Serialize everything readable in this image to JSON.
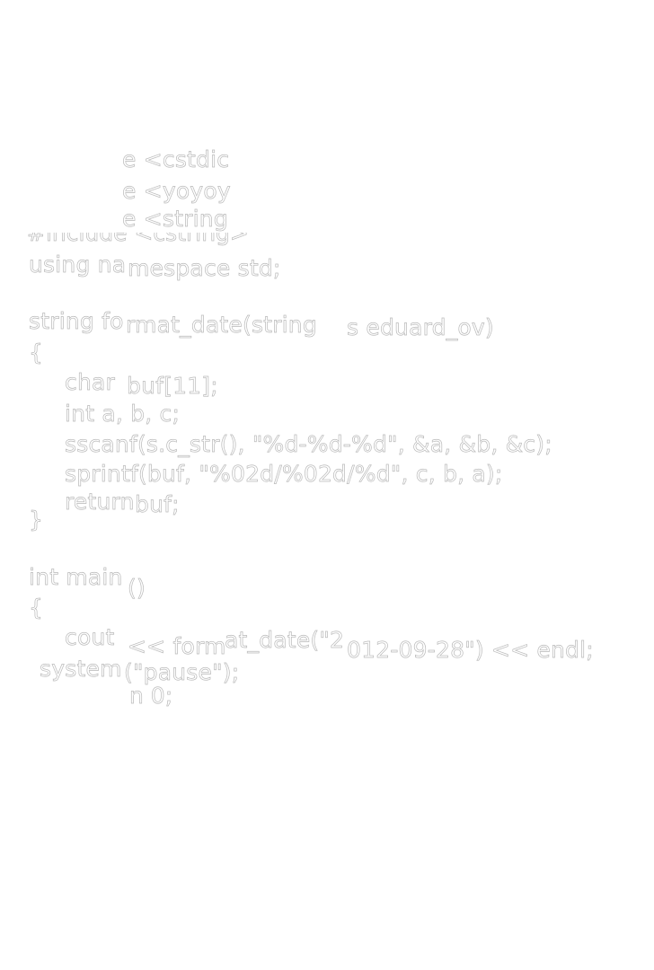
{
  "lines": {
    "include_cstdio": "e <cstdic",
    "include_yoyoy": "e <yoyoy",
    "include_string": "e <string",
    "clipped_line": "#include <cstring>",
    "using_a": "using na",
    "using_b": "mespace std;",
    "fn_a": "string fo",
    "fn_b": "rmat_date(string",
    "fn_c": "s eduard_ov)",
    "brace_open_1": "{",
    "char_a": "char",
    "char_b": "buf[11];",
    "int_vars": "int a, b, c;",
    "sscanf": "sscanf(s.c_str(), \"%d-%d-%d\", &a, &b, &c);",
    "sprintf": "sprintf(buf, \"%02d/%02d/%d\", c, b, a);",
    "ret_a": "return",
    "ret_b": "buf;",
    "brace_close_1": "}",
    "main_a": "int main",
    "main_b": "()",
    "brace_open_2": "{",
    "cout_a": "cout",
    "cout_b": "<< form",
    "cout_c": "at_date(\"2",
    "cout_d": "012-09-28\") << endl;",
    "sys_a": "system",
    "sys_b": "(\"pause\");",
    "ret0": "n 0;"
  }
}
